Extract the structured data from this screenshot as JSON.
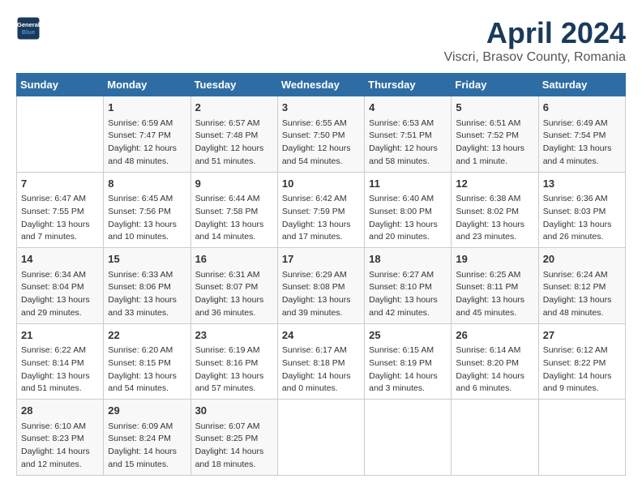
{
  "header": {
    "logo_line1": "General",
    "logo_line2": "Blue",
    "month": "April 2024",
    "location": "Viscri, Brasov County, Romania"
  },
  "days_of_week": [
    "Sunday",
    "Monday",
    "Tuesday",
    "Wednesday",
    "Thursday",
    "Friday",
    "Saturday"
  ],
  "weeks": [
    [
      {
        "day": "",
        "content": ""
      },
      {
        "day": "1",
        "content": "Sunrise: 6:59 AM\nSunset: 7:47 PM\nDaylight: 12 hours\nand 48 minutes."
      },
      {
        "day": "2",
        "content": "Sunrise: 6:57 AM\nSunset: 7:48 PM\nDaylight: 12 hours\nand 51 minutes."
      },
      {
        "day": "3",
        "content": "Sunrise: 6:55 AM\nSunset: 7:50 PM\nDaylight: 12 hours\nand 54 minutes."
      },
      {
        "day": "4",
        "content": "Sunrise: 6:53 AM\nSunset: 7:51 PM\nDaylight: 12 hours\nand 58 minutes."
      },
      {
        "day": "5",
        "content": "Sunrise: 6:51 AM\nSunset: 7:52 PM\nDaylight: 13 hours\nand 1 minute."
      },
      {
        "day": "6",
        "content": "Sunrise: 6:49 AM\nSunset: 7:54 PM\nDaylight: 13 hours\nand 4 minutes."
      }
    ],
    [
      {
        "day": "7",
        "content": "Sunrise: 6:47 AM\nSunset: 7:55 PM\nDaylight: 13 hours\nand 7 minutes."
      },
      {
        "day": "8",
        "content": "Sunrise: 6:45 AM\nSunset: 7:56 PM\nDaylight: 13 hours\nand 10 minutes."
      },
      {
        "day": "9",
        "content": "Sunrise: 6:44 AM\nSunset: 7:58 PM\nDaylight: 13 hours\nand 14 minutes."
      },
      {
        "day": "10",
        "content": "Sunrise: 6:42 AM\nSunset: 7:59 PM\nDaylight: 13 hours\nand 17 minutes."
      },
      {
        "day": "11",
        "content": "Sunrise: 6:40 AM\nSunset: 8:00 PM\nDaylight: 13 hours\nand 20 minutes."
      },
      {
        "day": "12",
        "content": "Sunrise: 6:38 AM\nSunset: 8:02 PM\nDaylight: 13 hours\nand 23 minutes."
      },
      {
        "day": "13",
        "content": "Sunrise: 6:36 AM\nSunset: 8:03 PM\nDaylight: 13 hours\nand 26 minutes."
      }
    ],
    [
      {
        "day": "14",
        "content": "Sunrise: 6:34 AM\nSunset: 8:04 PM\nDaylight: 13 hours\nand 29 minutes."
      },
      {
        "day": "15",
        "content": "Sunrise: 6:33 AM\nSunset: 8:06 PM\nDaylight: 13 hours\nand 33 minutes."
      },
      {
        "day": "16",
        "content": "Sunrise: 6:31 AM\nSunset: 8:07 PM\nDaylight: 13 hours\nand 36 minutes."
      },
      {
        "day": "17",
        "content": "Sunrise: 6:29 AM\nSunset: 8:08 PM\nDaylight: 13 hours\nand 39 minutes."
      },
      {
        "day": "18",
        "content": "Sunrise: 6:27 AM\nSunset: 8:10 PM\nDaylight: 13 hours\nand 42 minutes."
      },
      {
        "day": "19",
        "content": "Sunrise: 6:25 AM\nSunset: 8:11 PM\nDaylight: 13 hours\nand 45 minutes."
      },
      {
        "day": "20",
        "content": "Sunrise: 6:24 AM\nSunset: 8:12 PM\nDaylight: 13 hours\nand 48 minutes."
      }
    ],
    [
      {
        "day": "21",
        "content": "Sunrise: 6:22 AM\nSunset: 8:14 PM\nDaylight: 13 hours\nand 51 minutes."
      },
      {
        "day": "22",
        "content": "Sunrise: 6:20 AM\nSunset: 8:15 PM\nDaylight: 13 hours\nand 54 minutes."
      },
      {
        "day": "23",
        "content": "Sunrise: 6:19 AM\nSunset: 8:16 PM\nDaylight: 13 hours\nand 57 minutes."
      },
      {
        "day": "24",
        "content": "Sunrise: 6:17 AM\nSunset: 8:18 PM\nDaylight: 14 hours\nand 0 minutes."
      },
      {
        "day": "25",
        "content": "Sunrise: 6:15 AM\nSunset: 8:19 PM\nDaylight: 14 hours\nand 3 minutes."
      },
      {
        "day": "26",
        "content": "Sunrise: 6:14 AM\nSunset: 8:20 PM\nDaylight: 14 hours\nand 6 minutes."
      },
      {
        "day": "27",
        "content": "Sunrise: 6:12 AM\nSunset: 8:22 PM\nDaylight: 14 hours\nand 9 minutes."
      }
    ],
    [
      {
        "day": "28",
        "content": "Sunrise: 6:10 AM\nSunset: 8:23 PM\nDaylight: 14 hours\nand 12 minutes."
      },
      {
        "day": "29",
        "content": "Sunrise: 6:09 AM\nSunset: 8:24 PM\nDaylight: 14 hours\nand 15 minutes."
      },
      {
        "day": "30",
        "content": "Sunrise: 6:07 AM\nSunset: 8:25 PM\nDaylight: 14 hours\nand 18 minutes."
      },
      {
        "day": "",
        "content": ""
      },
      {
        "day": "",
        "content": ""
      },
      {
        "day": "",
        "content": ""
      },
      {
        "day": "",
        "content": ""
      }
    ]
  ]
}
